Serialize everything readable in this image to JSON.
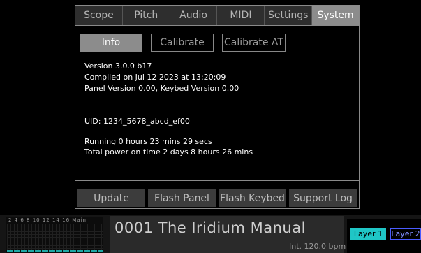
{
  "tabs": [
    "Scope",
    "Pitch",
    "Audio",
    "MIDI",
    "Settings",
    "System"
  ],
  "active_tab": "System",
  "subtabs": {
    "info": "Info",
    "calibrate": "Calibrate",
    "calibrate_at": "Calibrate AT"
  },
  "info": {
    "version": "Version 3.0.0 b17",
    "compiled": "Compiled on Jul 12 2023 at 13:20:09",
    "panel_version": "Panel Version 0.00, Keybed Version 0.00",
    "uid": "UID: 1234_5678_abcd_ef00",
    "running": "Running 0 hours 23 mins 29 secs",
    "total_power": "Total power on time 2 days 8 hours 26 mins"
  },
  "actions": {
    "update": "Update",
    "flash_panel": "Flash Panel",
    "flash_keybed": "Flash Keybed",
    "support_log": "Support Log"
  },
  "footer": {
    "meter_labels": "2  4  6  8 10 12 14 16 Main",
    "preset_name": "0001 The Iridium Manual",
    "tempo": "Int. 120.0 bpm",
    "layer1": "Layer 1",
    "layer2": "Layer 2"
  },
  "colors": {
    "accent_layer1": "#1fc6c6",
    "accent_layer2": "#4a5cff",
    "active_tab": "#8c8c8c"
  }
}
